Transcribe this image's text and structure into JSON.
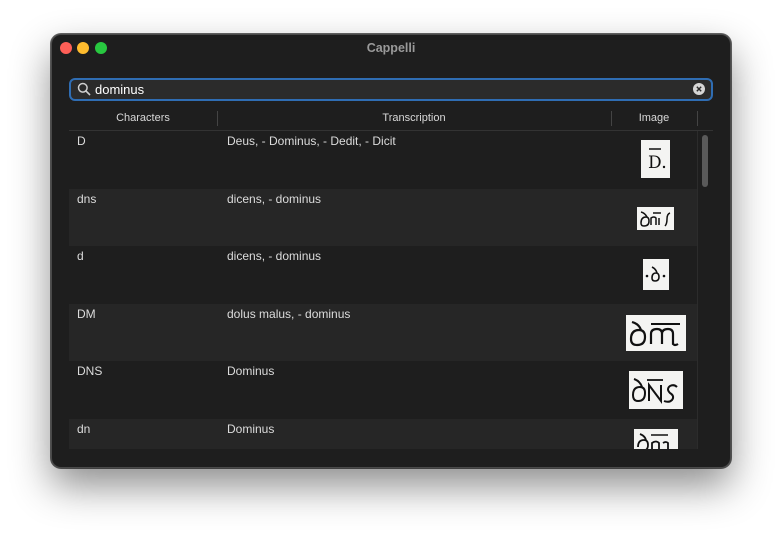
{
  "window": {
    "title": "Cappelli"
  },
  "search": {
    "value": "dominus",
    "icon": "magnifying-glass-icon",
    "clear_icon": "clear-circle-x-icon"
  },
  "table": {
    "columns": [
      "Characters",
      "Transcription",
      "Image"
    ],
    "rows": [
      {
        "characters": "D",
        "transcription": "Deus, - Dominus, - Dedit, - Dicit",
        "image": "abbreviation-D-with-bar"
      },
      {
        "characters": "dns",
        "transcription": "dicens, - dominus",
        "image": "abbreviation-dns"
      },
      {
        "characters": "d",
        "transcription": "dicens, - dominus",
        "image": "abbreviation-d-dotted"
      },
      {
        "characters": "DM",
        "transcription": "dolus malus, - dominus",
        "image": "abbreviation-DM"
      },
      {
        "characters": "DNS",
        "transcription": "Dominus",
        "image": "abbreviation-DNS"
      },
      {
        "characters": "dn",
        "transcription": "Dominus",
        "image": "abbreviation-dn"
      }
    ]
  }
}
